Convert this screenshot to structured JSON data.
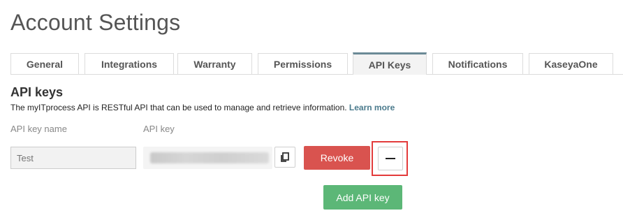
{
  "page": {
    "title": "Account Settings"
  },
  "tabs": [
    {
      "label": "General"
    },
    {
      "label": "Integrations"
    },
    {
      "label": "Warranty"
    },
    {
      "label": "Permissions"
    },
    {
      "label": "API Keys",
      "active": true
    },
    {
      "label": "Notifications"
    },
    {
      "label": "KaseyaOne"
    }
  ],
  "section": {
    "title": "API keys",
    "description": "The myITprocess API is RESTful API that can be used to manage and retrieve information.",
    "learn_more": "Learn more"
  },
  "columns": {
    "name_label": "API key name",
    "key_label": "API key"
  },
  "api_key_row": {
    "name_placeholder": "Test",
    "key_value_state": "redacted",
    "copy_icon": "copy-icon",
    "revoke_label": "Revoke",
    "remove_icon": "minus-icon"
  },
  "actions": {
    "add_label": "Add API key"
  },
  "colors": {
    "revoke": "#d9534f",
    "add": "#5cb777",
    "active_tab_accent": "#6b8a96",
    "highlight": "#e33b3b",
    "link": "#4a7a8c"
  }
}
